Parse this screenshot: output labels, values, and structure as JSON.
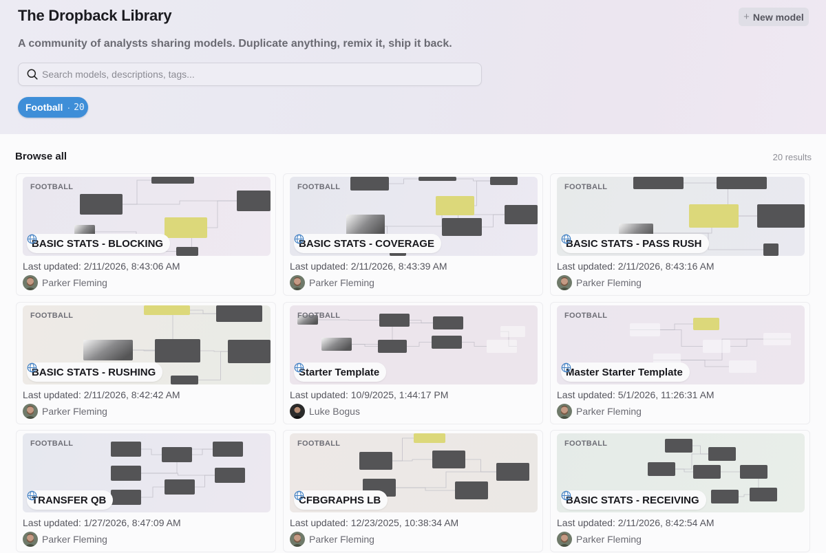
{
  "header": {
    "title": "The Dropback Library",
    "new_model_label": "New model",
    "subtitle": "A community of analysts sharing models. Duplicate anything, remix it, ship it back.",
    "search_placeholder": "Search models, descriptions, tags..."
  },
  "filter_chip": {
    "label": "Football",
    "separator": "·",
    "count": "20"
  },
  "browse": {
    "heading": "Browse all",
    "results": "20 results"
  },
  "colors": {
    "accent": "#3e8ed8",
    "node": "#545456",
    "highlight": "#dcd87a"
  },
  "cards": [
    {
      "tag": "FOOTBALL",
      "title": "BASIC STATS - BLOCKING",
      "updated": "Last updated: 2/11/2026, 8:43:06 AM",
      "author": "Parker Fleming",
      "avatar": "bearded"
    },
    {
      "tag": "FOOTBALL",
      "title": "BASIC STATS - COVERAGE",
      "updated": "Last updated: 2/11/2026, 8:43:39 AM",
      "author": "Parker Fleming",
      "avatar": "bearded"
    },
    {
      "tag": "FOOTBALL",
      "title": "BASIC STATS - PASS RUSH",
      "updated": "Last updated: 2/11/2026, 8:43:16 AM",
      "author": "Parker Fleming",
      "avatar": "bearded"
    },
    {
      "tag": "FOOTBALL",
      "title": "BASIC STATS - RUSHING",
      "updated": "Last updated: 2/11/2026, 8:42:42 AM",
      "author": "Parker Fleming",
      "avatar": "bearded"
    },
    {
      "tag": "FOOTBALL",
      "title": "Starter Template",
      "updated": "Last updated: 10/9/2025, 1:44:17 PM",
      "author": "Luke Bogus",
      "avatar": "dark"
    },
    {
      "tag": "FOOTBALL",
      "title": "Master Starter Template",
      "updated": "Last updated: 5/1/2026, 11:26:31 AM",
      "author": "Parker Fleming",
      "avatar": "bearded"
    },
    {
      "tag": "FOOTBALL",
      "title": "TRANSFER QB",
      "updated": "Last updated: 1/27/2026, 8:47:09 AM",
      "author": "Parker Fleming",
      "avatar": "bearded"
    },
    {
      "tag": "FOOTBALL",
      "title": "CFBGRAPHS LB",
      "updated": "Last updated: 12/23/2025, 10:38:34 AM",
      "author": "Parker Fleming",
      "avatar": "bearded"
    },
    {
      "tag": "FOOTBALL",
      "title": "BASIC STATS - RECEIVING",
      "updated": "Last updated: 2/11/2026, 8:42:54 AM",
      "author": "Parker Fleming",
      "avatar": "bearded"
    }
  ]
}
